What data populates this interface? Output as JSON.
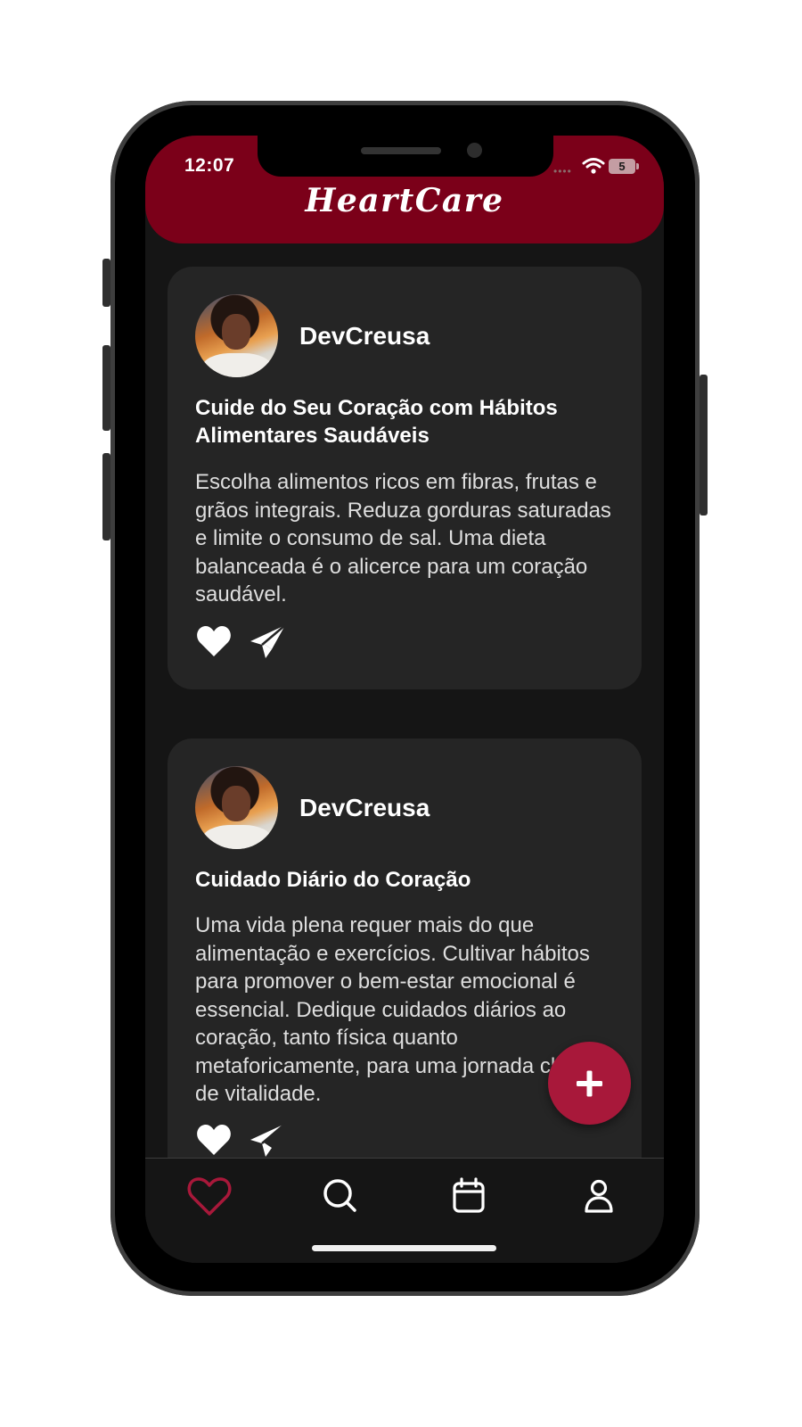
{
  "status_bar": {
    "time": "12:07",
    "battery": "5"
  },
  "header": {
    "app_title": "HeartCare"
  },
  "posts": [
    {
      "author": "DevCreusa",
      "title": "Cuide do Seu Coração com Hábitos Alimentares Saudáveis",
      "body": "Escolha alimentos ricos em fibras, frutas e grãos integrais. Reduza gorduras saturadas e limite o consumo de sal. Uma dieta balanceada é o alicerce para um coração saudável."
    },
    {
      "author": "DevCreusa",
      "title": "Cuidado Diário do Coração",
      "body": "Uma vida plena requer mais do que alimentação e exercícios. Cultivar hábitos para promover o bem-estar emocional é essencial. Dedique cuidados diários ao coração, tanto física quanto metaforicamente, para uma jornada cheia de vitalidade."
    }
  ],
  "icons": {
    "post_actions": [
      "heart-icon",
      "send-icon"
    ],
    "fab": "plus-icon",
    "tabs": [
      "heart-outline-icon",
      "search-icon",
      "calendar-icon",
      "user-icon"
    ]
  },
  "colors": {
    "brand": "#7b0019",
    "accent": "#a8183a",
    "active_tab": "#a8183a",
    "card": "#252525",
    "background": "#151515"
  }
}
